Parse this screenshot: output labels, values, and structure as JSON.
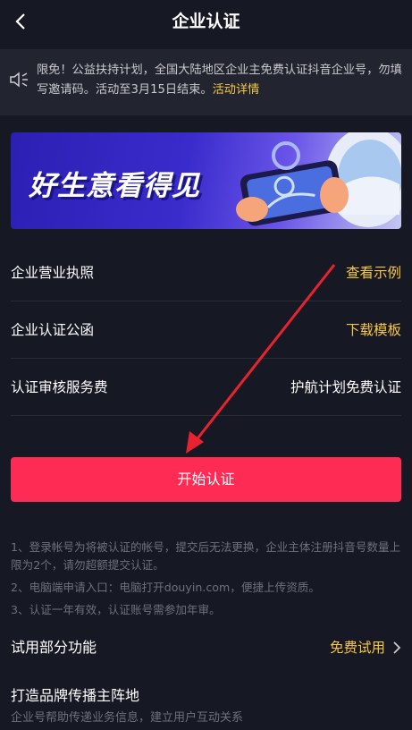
{
  "nav": {
    "title": "企业认证"
  },
  "notice": {
    "text": "限免！公益扶持计划，全国大陆地区企业主免费认证抖音企业号，勿填写邀请码。活动至3月15日结束。",
    "link": "活动详情"
  },
  "banner": {
    "title": "好生意看得见"
  },
  "rows": [
    {
      "label": "企业营业执照",
      "value": "查看示例"
    },
    {
      "label": "企业认证公函",
      "value": "下载模板"
    },
    {
      "label": "认证审核服务费",
      "value": "护航计划免费认证"
    }
  ],
  "start_button": "开始认证",
  "notes": [
    "1、登录帐号为将被认证的帐号，提交后无法更换，企业主体注册抖音号数量上限为2个，请勿超额提交认证。",
    "2、电脑端申请入口：电脑打开douyin.com，便捷上传资质。",
    "3、认证一年有效，认证账号需参加年审。"
  ],
  "trial": {
    "label": "试用部分功能",
    "value": "免费试用"
  },
  "brand": {
    "title": "打造品牌传播主阵地",
    "subtitle": "企业号帮助传递业务信息，建立用户互动关系"
  },
  "colors": {
    "accent": "#fe2c55",
    "highlight": "#f5c744",
    "background": "#161823"
  }
}
